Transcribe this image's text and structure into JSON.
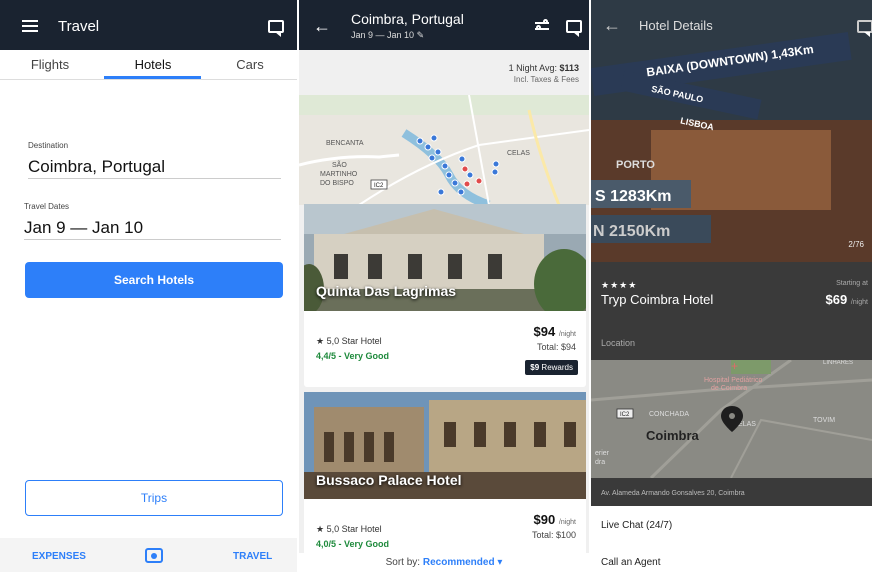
{
  "search_screen": {
    "app_title": "Travel",
    "tabs": [
      {
        "label": "Flights"
      },
      {
        "label": "Hotels"
      },
      {
        "label": "Cars"
      }
    ],
    "destination_label": "Destination",
    "destination_value": "Coimbra, Portugal",
    "dates_label": "Travel Dates",
    "dates_value": "Jan 9 — Jan 10",
    "search_button": "Search Hotels",
    "trips_button": "Trips",
    "bottom_nav": {
      "left": "EXPENSES",
      "right": "TRAVEL"
    },
    "icons": [
      "menu-icon",
      "chat-icon",
      "camera-icon"
    ],
    "accent_color": "#2d7ff9",
    "bar_color": "#1a2330"
  },
  "results_screen": {
    "title": "Coimbra, Portugal",
    "subtitle": "Jan 9 — Jan 10",
    "avg_label": "1 Night Avg:",
    "avg_value": "$113",
    "avg_note": "Incl. Taxes & Fees",
    "map_labels": [
      "BENCANTA",
      "SÃO",
      "MARTINHO",
      "DO BISPO",
      "CELAS",
      "IC2"
    ],
    "hotels": [
      {
        "name": "Quinta Das Lagrimas",
        "stars": "5,0 Star Hotel",
        "rating": "4,4/5 - Very Good",
        "price": "$94",
        "per": "/night",
        "total": "Total: $94",
        "rewards_value": "$9",
        "rewards_label": "Rewards"
      },
      {
        "name": "Bussaco Palace Hotel",
        "stars": "5,0 Star Hotel",
        "rating": "4,0/5 - Very Good",
        "price": "$90",
        "per": "/night",
        "total": "Total: $100"
      }
    ],
    "sort_label": "Sort by:",
    "sort_value": "Recommended",
    "rating_color": "#1e8a3c"
  },
  "details_screen": {
    "title": "Hotel Details",
    "photo_counter": "2/76",
    "sign_texts": [
      "BAIXA (DOWNTOWN) 1,43Km",
      "SÃO PAULO",
      "LISBOA",
      "PORTO",
      "S 1283Km",
      "N 2150Km"
    ],
    "stars": "★★★★",
    "hotel_name": "Tryp Coimbra Hotel",
    "starting_label": "Starting at",
    "price": "$69",
    "per": "/night",
    "location_label": "Location",
    "map_labels": [
      "Hospital Pediátrico",
      "de Coimbra",
      "CONCHADA",
      "CELAS",
      "Coimbra",
      "TOVIM",
      "LINHARES",
      "IC2",
      "erier",
      "dra"
    ],
    "address": "Av. Alameda Armando Gonsalves 20, Coimbra",
    "actions": [
      "Live Chat (24/7)",
      "Call an Agent"
    ]
  }
}
